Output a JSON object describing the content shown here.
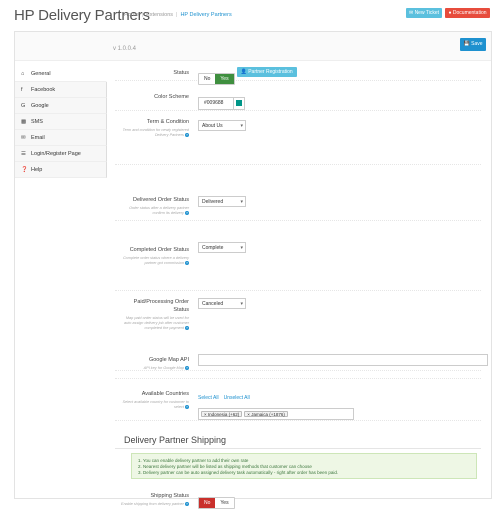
{
  "header": {
    "title": "HP Delivery Partners",
    "breadcrumb": [
      "Home",
      "Extensions",
      "HP Delivery Partners"
    ],
    "buttons": {
      "ticket": "New Ticket",
      "documentation": "Documentation"
    }
  },
  "panel": {
    "version": "v 1.0.0.4",
    "save": "Save"
  },
  "sidebar": {
    "items": [
      {
        "icon": "home-icon",
        "label": "General"
      },
      {
        "icon": "facebook-icon",
        "label": "Facebook"
      },
      {
        "icon": "google-icon",
        "label": "Google"
      },
      {
        "icon": "sms-icon",
        "label": "SMS"
      },
      {
        "icon": "email-icon",
        "label": "Email"
      },
      {
        "icon": "login-icon",
        "label": "Login/Register Page"
      },
      {
        "icon": "help-icon",
        "label": "Help"
      }
    ]
  },
  "form": {
    "status": {
      "label": "Status",
      "no": "No",
      "yes": "Yes",
      "registration": "Partner Registration"
    },
    "color_scheme": {
      "label": "Color Scheme",
      "value": "#009688",
      "color": "#009688"
    },
    "term": {
      "label": "Term & Condition",
      "help": "Term and condition for newly registered Delivery Partners",
      "value": "About Us"
    },
    "delivered": {
      "label": "Delivered Order Status",
      "help": "Order status after a delivery partner confirm its delivery",
      "value": "Delivered"
    },
    "completed": {
      "label": "Completed Order Status",
      "help": "Complete order status where a delivery partner got commission",
      "value": "Complete"
    },
    "paid": {
      "label": "Paid/Processing Order Status",
      "help": "Map paid order status will be used for auto assign delivery job after customer completed the payment",
      "value": "Canceled"
    },
    "google_map": {
      "label": "Google Map API",
      "help": "API key for Google Map",
      "value": ""
    },
    "countries": {
      "label": "Available Countries",
      "help": "Select available country for customer to select",
      "select_all": "Select All",
      "unselect_all": "Unselect All",
      "tags": [
        "Indonesia (+62)",
        "Jamaica (+1876)"
      ]
    }
  },
  "shipping": {
    "title": "Delivery Partner Shipping",
    "info": [
      "1. You can enable delivery partner to add their own rate",
      "2. Nearest delivery partner will be listed as shipping methods that customer can choose",
      "3. Delivery partner can be auto assigned delivery task automatically - right after order has been paid."
    ],
    "status": {
      "label": "Shipping Status",
      "help": "Enable shipping from delivery partner",
      "no": "No",
      "yes": "Yes"
    }
  },
  "colors": {
    "accent": "#1e91cf",
    "success": "#3f8f3f",
    "danger": "#c9302c",
    "info": "#5bc0de"
  }
}
